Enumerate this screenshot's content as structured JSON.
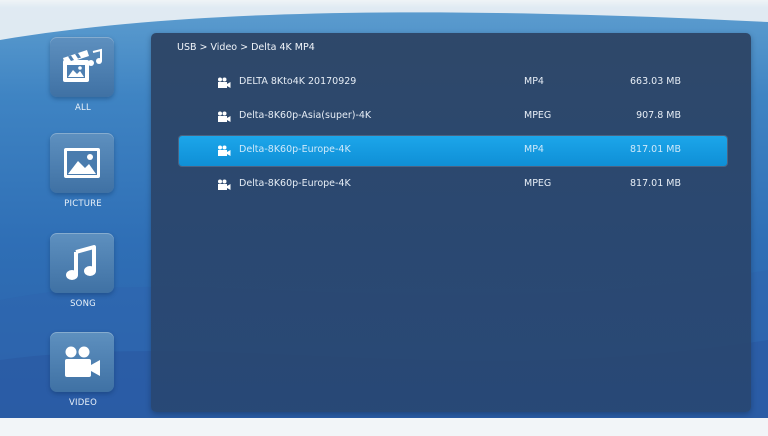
{
  "sidebar": {
    "items": [
      {
        "label": "ALL",
        "icon": "media-all-icon"
      },
      {
        "label": "PICTURE",
        "icon": "picture-icon"
      },
      {
        "label": "SONG",
        "icon": "music-note-icon"
      },
      {
        "label": "VIDEO",
        "icon": "video-camera-icon"
      }
    ]
  },
  "breadcrumb": "USB > Video > Delta 4K MP4",
  "files": [
    {
      "name": "DELTA 8Kto4K 20170929",
      "type": "MP4",
      "size": "663.03 MB",
      "icon": "video-file-icon"
    },
    {
      "name": "Delta-8K60p-Asia(super)-4K",
      "type": "MPEG",
      "size": "907.8 MB",
      "icon": "video-file-icon"
    },
    {
      "name": "Delta-8K60p-Europe-4K",
      "type": "MP4",
      "size": "817.01 MB",
      "icon": "video-file-icon"
    },
    {
      "name": "Delta-8K60p-Europe-4K",
      "type": "MPEG",
      "size": "817.01 MB",
      "icon": "video-file-icon"
    }
  ],
  "selected_index": 2,
  "colors": {
    "selection": "#1ca6ea",
    "panel": "#2c4262",
    "background": "#3f84c3"
  }
}
